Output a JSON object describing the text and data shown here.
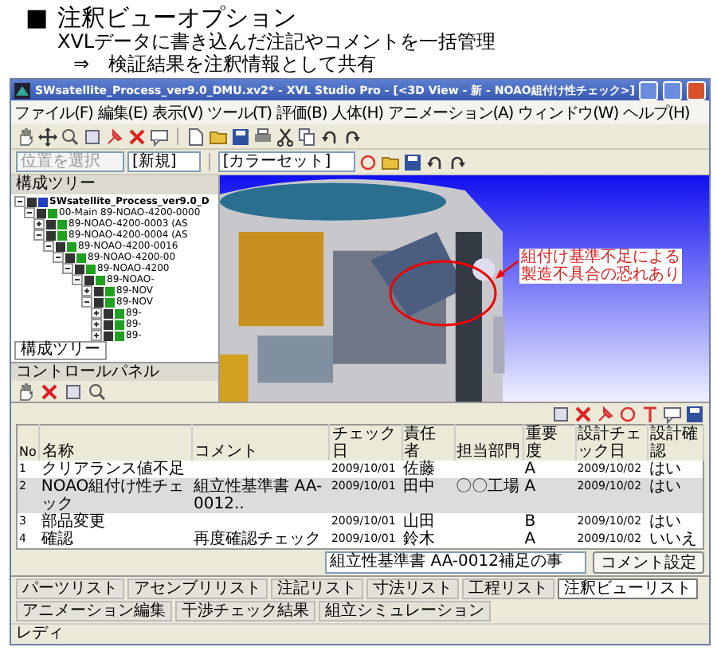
{
  "slide": {
    "bullet": "■",
    "title": "注釈ビューオプション",
    "lines": [
      "XVLデータに書き込んだ注記やコメントを一括管理",
      "⇒　検証結果を注釈情報として共有"
    ]
  },
  "window": {
    "title": "SWsatellite_Process_ver9.0_DMU.xv2* - XVL Studio Pro - [<3D View - 新 - NOAO組付け性チェック>]"
  },
  "menu": [
    "ファイル(F)",
    "編集(E)",
    "表示(V)",
    "ツール(T)",
    "評価(B)",
    "人体(H)",
    "アニメーション(A)",
    "ウィンドウ(W)",
    "ヘルプ(H)"
  ],
  "toolbar": {
    "position_combo": {
      "placeholder": "位置を選択"
    },
    "view_combo": "[新規]",
    "color_combo": "[カラーセット]"
  },
  "tree_panel": {
    "title": "構成ツリー",
    "tab": "構成ツリー",
    "items": [
      {
        "label": "SWsatellite_Process_ver9.0_D",
        "checked": true,
        "expanded": true,
        "children": [
          {
            "label": "00-Main 89-NOAO-4200-0000",
            "checked": true,
            "expanded": true,
            "children": [
              {
                "label": "89-NOAO-4200-0003 (AS",
                "checked": true,
                "expanded": false
              },
              {
                "label": "89-NOAO-4200-0004 (AS",
                "checked": true,
                "expanded": true,
                "children": [
                  {
                    "label": "89-NOAO-4200-0016",
                    "checked": true,
                    "expanded": true,
                    "children": [
                      {
                        "label": "89-NOAO-4200-00",
                        "checked": true,
                        "expanded": true,
                        "children": [
                          {
                            "label": "89-NOAO-4200",
                            "checked": true,
                            "expanded": true,
                            "children": [
                              {
                                "label": "89-NOAO-",
                                "checked": true,
                                "expanded": true,
                                "children": [
                                  {
                                    "label": "89-NOV",
                                    "checked": true,
                                    "expanded": false
                                  },
                                  {
                                    "label": "89-NOV",
                                    "checked": true,
                                    "expanded": true,
                                    "children": [
                                      {
                                        "label": "89-",
                                        "checked": true,
                                        "expanded": false
                                      },
                                      {
                                        "label": "89-",
                                        "checked": true,
                                        "expanded": false
                                      },
                                      {
                                        "label": "89-",
                                        "checked": true,
                                        "expanded": false
                                      }
                                    ]
                                  }
                                ]
                              }
                            ]
                          }
                        ]
                      }
                    ]
                  }
                ]
              }
            ]
          }
        ]
      }
    ]
  },
  "control_panel": {
    "title": "コントロールパネル"
  },
  "view": {
    "annotation": [
      "組付け基準不足による",
      "製造不具合の恐れあり"
    ]
  },
  "annotation_table": {
    "columns": [
      "No",
      "名称",
      "コメント",
      "チェック日",
      "責任者",
      "担当部門",
      "重要度",
      "設計チェック日",
      "設計確認"
    ],
    "rows": [
      {
        "no": "1",
        "name": "クリアランス値不足",
        "check_date": "2009/10/01",
        "owner": "佐藤",
        "importance": "A",
        "design_date": "2009/10/02",
        "design_ok": "はい",
        "selected": false
      },
      {
        "no": "2",
        "name": "NOAO組付け性チェック",
        "comment": "組立性基準書 AA-0012..",
        "check_date": "2009/10/01",
        "owner": "田中",
        "department": "〇〇工場",
        "importance": "A",
        "design_date": "2009/10/02",
        "design_ok": "はい",
        "selected": true
      },
      {
        "no": "3",
        "name": "部品変更",
        "check_date": "2009/10/01",
        "owner": "山田",
        "importance": "B",
        "design_date": "2009/10/02",
        "design_ok": "はい",
        "selected": false
      },
      {
        "no": "4",
        "name": "確認",
        "comment": "再度確認チェック",
        "check_date": "2009/10/01",
        "owner": "鈴木",
        "importance": "A",
        "design_date": "2009/10/02",
        "design_ok": "いいえ",
        "selected": false
      }
    ],
    "comment_combo": "組立性基準書 AA-0012補足の事",
    "comment_button": "コメント設定"
  },
  "bottom_tabs": [
    {
      "label": "パーツリスト",
      "selected": false
    },
    {
      "label": "アセンブリリスト",
      "selected": false
    },
    {
      "label": "注記リスト",
      "selected": false
    },
    {
      "label": "寸法リスト",
      "selected": false
    },
    {
      "label": "工程リスト",
      "selected": false
    },
    {
      "label": "注釈ビューリスト",
      "selected": true
    },
    {
      "label": "アニメーション編集",
      "selected": false
    },
    {
      "label": "干渉チェック結果",
      "selected": false
    },
    {
      "label": "組立シミュレーション",
      "selected": false
    }
  ],
  "status_bar": "レディ"
}
